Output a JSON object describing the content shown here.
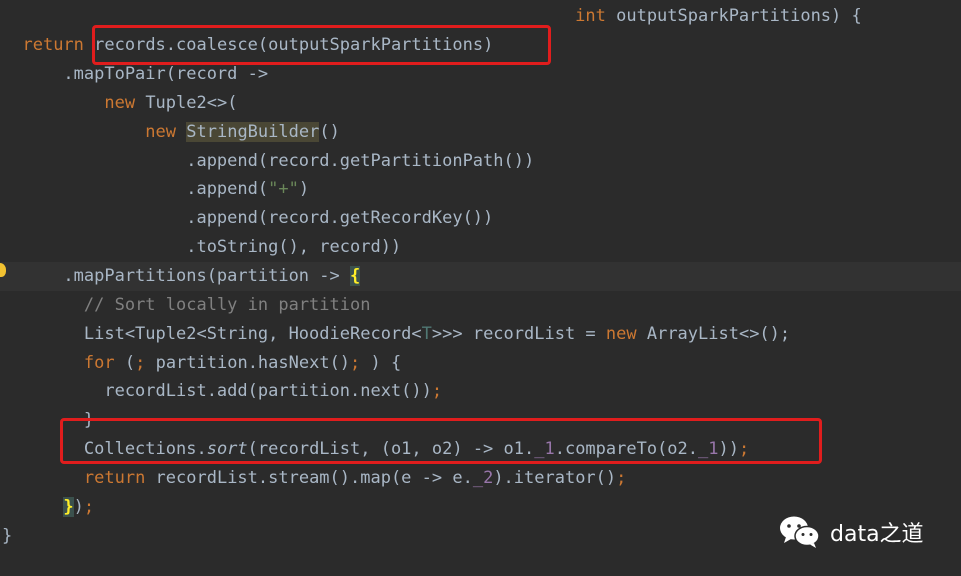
{
  "code_lines": [
    {
      "tokens": [
        {
          "t": "                                                        ",
          "c": ""
        },
        {
          "t": "int",
          "c": "tok-kw"
        },
        {
          "t": " outputSparkPartitions) {",
          "c": ""
        }
      ]
    },
    {
      "tokens": [
        {
          "t": "  ",
          "c": ""
        },
        {
          "t": "return",
          "c": "tok-kw"
        },
        {
          "t": " records.coalesce(outputSparkPartitions)",
          "c": ""
        }
      ]
    },
    {
      "tokens": [
        {
          "t": "      .mapToPair(record ->",
          "c": ""
        }
      ]
    },
    {
      "tokens": [
        {
          "t": "          ",
          "c": ""
        },
        {
          "t": "new",
          "c": "tok-kw"
        },
        {
          "t": " Tuple2<>(",
          "c": ""
        }
      ]
    },
    {
      "tokens": [
        {
          "t": "              ",
          "c": ""
        },
        {
          "t": "new",
          "c": "tok-kw"
        },
        {
          "t": " ",
          "c": ""
        },
        {
          "t": "StringBuilder",
          "c": "hl-sb"
        },
        {
          "t": "()",
          "c": ""
        }
      ]
    },
    {
      "tokens": [
        {
          "t": "                  .append(record.getPartitionPath())",
          "c": ""
        }
      ]
    },
    {
      "tokens": [
        {
          "t": "                  .append(",
          "c": ""
        },
        {
          "t": "\"+\"",
          "c": "tok-str"
        },
        {
          "t": ")",
          "c": ""
        }
      ]
    },
    {
      "tokens": [
        {
          "t": "                  .append(record.getRecordKey())",
          "c": ""
        }
      ]
    },
    {
      "tokens": [
        {
          "t": "                  .toString(), record))",
          "c": ""
        }
      ]
    },
    {
      "tokens": [
        {
          "t": "      .mapPartitions(partition -> ",
          "c": ""
        },
        {
          "t": "{",
          "c": "brace-match"
        }
      ]
    },
    {
      "tokens": [
        {
          "t": "        ",
          "c": ""
        },
        {
          "t": "// Sort locally in partition",
          "c": "tok-cmt"
        }
      ]
    },
    {
      "tokens": [
        {
          "t": "        List<Tuple2<String, HoodieRecord<",
          "c": ""
        },
        {
          "t": "T",
          "c": "tok-gen"
        },
        {
          "t": ">>> recordList = ",
          "c": ""
        },
        {
          "t": "new",
          "c": "tok-kw"
        },
        {
          "t": " ArrayList<>();",
          "c": ""
        }
      ]
    },
    {
      "tokens": [
        {
          "t": "        ",
          "c": ""
        },
        {
          "t": "for",
          "c": "tok-kw"
        },
        {
          "t": " (",
          "c": ""
        },
        {
          "t": ";",
          "c": "tok-kw"
        },
        {
          "t": " partition.hasNext()",
          "c": ""
        },
        {
          "t": ";",
          "c": "tok-kw"
        },
        {
          "t": " ) {",
          "c": ""
        }
      ]
    },
    {
      "tokens": [
        {
          "t": "          recordList.add(partition.next())",
          "c": ""
        },
        {
          "t": ";",
          "c": "tok-kw"
        }
      ]
    },
    {
      "tokens": [
        {
          "t": "        }",
          "c": ""
        }
      ]
    },
    {
      "tokens": [
        {
          "t": "        Collections.",
          "c": ""
        },
        {
          "t": "sort",
          "c": "tok-static"
        },
        {
          "t": "(recordList, (o1, o2) -> o1.",
          "c": ""
        },
        {
          "t": "_1",
          "c": "tok-field"
        },
        {
          "t": ".compareTo(o2.",
          "c": ""
        },
        {
          "t": "_1",
          "c": "tok-field"
        },
        {
          "t": "))",
          "c": ""
        },
        {
          "t": ";",
          "c": "tok-kw"
        }
      ]
    },
    {
      "tokens": [
        {
          "t": "        ",
          "c": ""
        },
        {
          "t": "return",
          "c": "tok-kw"
        },
        {
          "t": " recordList.stream().map(e -> e.",
          "c": ""
        },
        {
          "t": "_2",
          "c": "tok-field"
        },
        {
          "t": ").iterator()",
          "c": ""
        },
        {
          "t": ";",
          "c": "tok-kw"
        }
      ]
    },
    {
      "tokens": [
        {
          "t": "      ",
          "c": ""
        },
        {
          "t": "}",
          "c": "brace-match"
        },
        {
          "t": ")",
          "c": ""
        },
        {
          "t": ";",
          "c": "tok-kw"
        }
      ]
    },
    {
      "tokens": [
        {
          "t": "}",
          "c": ""
        }
      ]
    }
  ],
  "watermark": {
    "text": "data之道",
    "icon": "wechat-icon"
  },
  "colors": {
    "background": "#2b2b2b",
    "text": "#a9b7c6",
    "keyword": "#cc7832",
    "string": "#6a8759",
    "comment": "#808080",
    "field": "#9876aa",
    "highlight_box": "#e01d1d"
  }
}
